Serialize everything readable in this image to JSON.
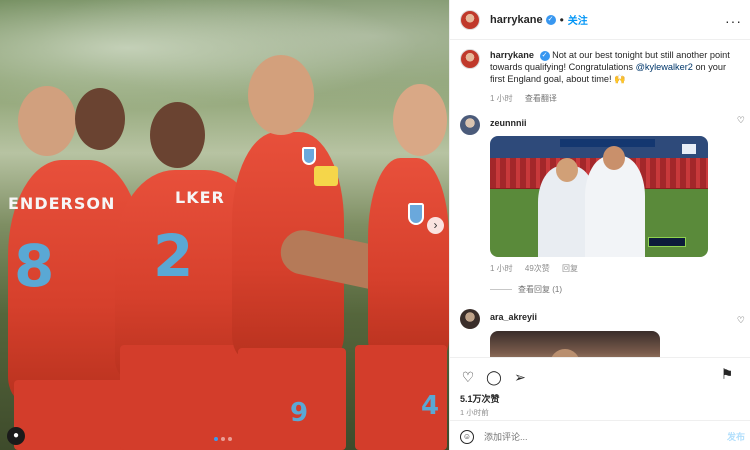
{
  "photo": {
    "player1": {
      "name": "ENDERSON",
      "number": "8"
    },
    "player2": {
      "name": "LKER",
      "number": "2"
    },
    "player3": {
      "number": "9"
    },
    "player4": {
      "number": "4"
    },
    "carousel_next_icon": "chevron-right-icon",
    "user_tag_icon": "person-icon"
  },
  "header": {
    "username": "harrykane",
    "follow_label": "关注",
    "more_icon": "ellipsis-icon"
  },
  "caption": {
    "username": "harrykane",
    "text_part1": "Not at our best tonight but still another point towards qualifying! Congratulations ",
    "mention": "@kylewalker2",
    "text_part2": " on your first England goal, about time! 🙌",
    "time": "1 小时",
    "translate": "查看翻译"
  },
  "comments": [
    {
      "username": "zeunnnii",
      "time": "1 小时",
      "likes": "49次赞",
      "reply": "回复",
      "view_replies": "查看回复 (1)"
    },
    {
      "username": "ara_akreyii"
    }
  ],
  "footer": {
    "likes": "5.1万次赞",
    "time_ago": "1 小时前",
    "add_comment_placeholder": "添加评论...",
    "post_label": "发布"
  },
  "colors": {
    "accent": "#0095f6",
    "verified": "#3897f0",
    "england_red": "#e4473a"
  }
}
